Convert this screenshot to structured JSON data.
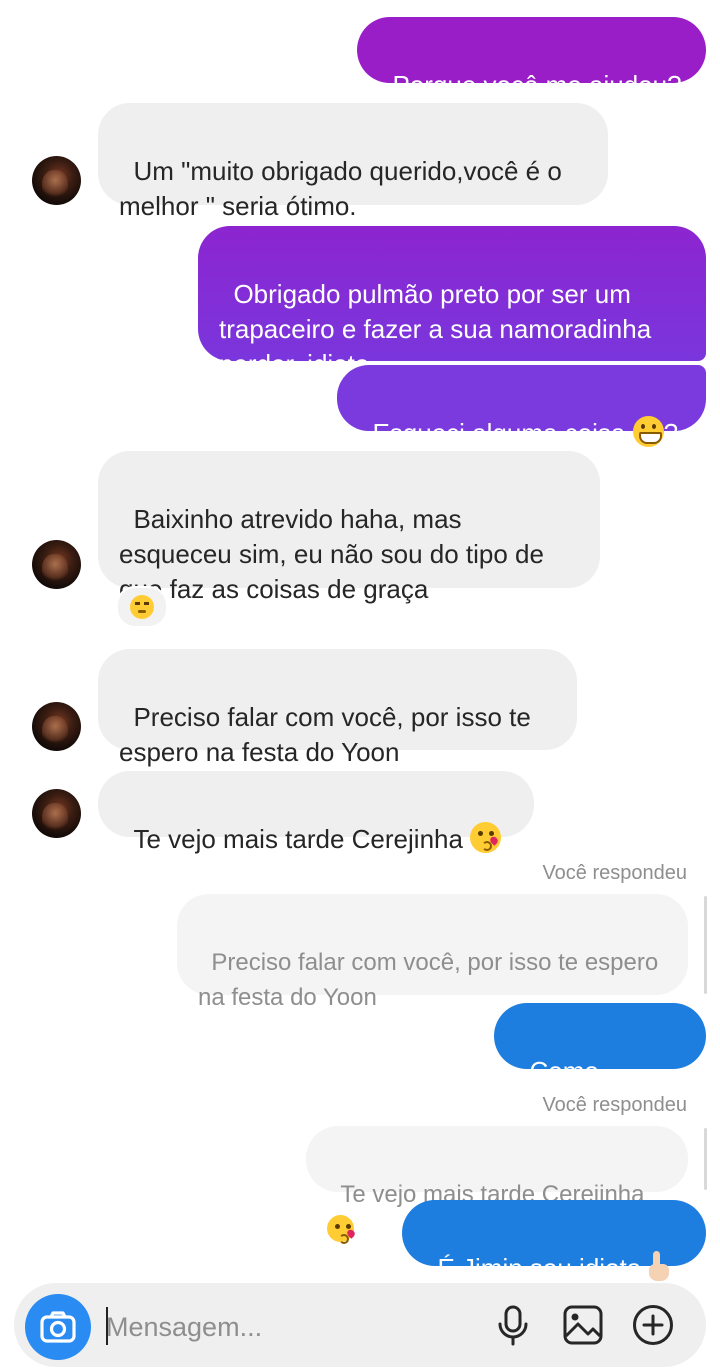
{
  "messages": {
    "m1": "Porque você me ajudou?",
    "m2": "Um \"muito obrigado querido,você é o\nmelhor \" seria ótimo.",
    "m3": "Obrigado pulmão preto por ser um\ntrapaceiro e fazer a sua namoradinha\nperder, idiota.",
    "m4": "Esqueci alguma coisa ",
    "m4_suffix": "?",
    "m5": "Baixinho atrevido haha, mas\nesqueceu sim, eu não sou do tipo de\nque faz as coisas de graça",
    "m6": "Preciso falar com você, por isso te\nespero na festa do Yoon",
    "m7": "Te vejo mais tarde Cerejinha ",
    "m8": "Como assim?",
    "m9": "É Jimin seu idiota "
  },
  "replies": {
    "label_1": "Você respondeu",
    "quoted_1": "Preciso falar com você, por isso te espero\nna festa do Yoon",
    "label_2": "Você respondeu",
    "quoted_2": "Te vejo mais tarde Cerejinha "
  },
  "composer": {
    "placeholder": "Mensagem..."
  },
  "icons": {
    "camera": "camera-icon",
    "mic": "microphone-icon",
    "gallery": "image-icon",
    "more": "plus-circle-icon",
    "emoji_grin": "grinning-face-emoji",
    "emoji_kiss": "kissing-heart-emoji",
    "emoji_unamused": "unamused-face-emoji",
    "emoji_hand": "middle-finger-emoji"
  },
  "colors": {
    "sent_gradient_top": "#9b1fc6",
    "sent_gradient_bottom": "#7a3be0",
    "sent_blue": "#1e7ee0",
    "received_bg": "#efefef",
    "camera_button": "#2a8bf2"
  }
}
